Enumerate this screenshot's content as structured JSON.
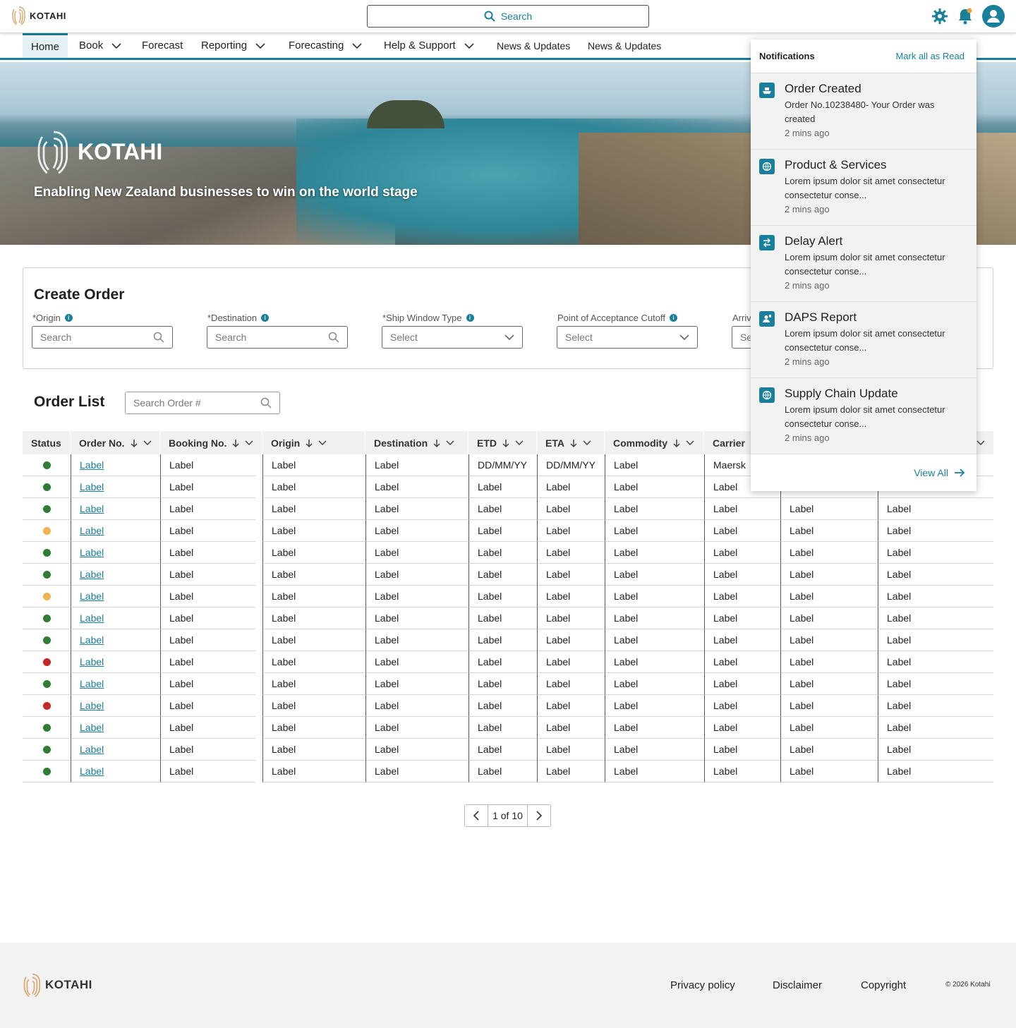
{
  "header": {
    "logo_text": "KOTAHI",
    "search_label": "Search"
  },
  "nav": {
    "items": [
      {
        "label": "Home"
      },
      {
        "label": "Book"
      },
      {
        "label": "Forecast"
      },
      {
        "label": "Reporting"
      },
      {
        "label": "Forecasting"
      },
      {
        "label": "Help & Support"
      },
      {
        "label": "News & Updates"
      },
      {
        "label": "News & Updates"
      }
    ]
  },
  "hero": {
    "logo_text": "KOTAHI",
    "tagline": "Enabling New Zealand businesses to win on the world stage"
  },
  "create_order": {
    "title": "Create Order",
    "fields": [
      {
        "label": "*Origin",
        "placeholder": "Search"
      },
      {
        "label": "*Destination",
        "placeholder": "Search"
      },
      {
        "label": "*Ship Window Type",
        "placeholder": "Select"
      },
      {
        "label": "Point of Acceptance Cutoff",
        "placeholder": "Select"
      },
      {
        "label": "Arriv",
        "placeholder": "Se"
      }
    ]
  },
  "order_list": {
    "title": "Order List",
    "search_placeholder": "Search Order #",
    "columns": [
      "Status",
      "Order No.",
      "Booking No.",
      "Origin",
      "Destination",
      "ETD",
      "ETA",
      "Commodity",
      "Carrier"
    ],
    "status_colors": {
      "green": "#2e7d32",
      "amber": "#f0b450",
      "red": "#c62828"
    },
    "rows": [
      {
        "status": "green",
        "order": "Label",
        "booking": "Label",
        "origin": "Label",
        "destination": "Label",
        "etd": "DD/MM/YY",
        "eta": "DD/MM/YY",
        "commodity": "Label",
        "carrier": "Maersk",
        "c10": "",
        "c11": ""
      },
      {
        "status": "green",
        "order": "Label",
        "booking": "Label",
        "origin": "Label",
        "destination": "Label",
        "etd": "Label",
        "eta": "Label",
        "commodity": "Label",
        "carrier": "Label",
        "c10": "",
        "c11": ""
      },
      {
        "status": "green",
        "order": "Label",
        "booking": "Label",
        "origin": "Label",
        "destination": "Label",
        "etd": "Label",
        "eta": "Label",
        "commodity": "Label",
        "carrier": "Label",
        "c10": "Label",
        "c11": "Label"
      },
      {
        "status": "amber",
        "order": "Label",
        "booking": "Label",
        "origin": "Label",
        "destination": "Label",
        "etd": "Label",
        "eta": "Label",
        "commodity": "Label",
        "carrier": "Label",
        "c10": "Label",
        "c11": "Label"
      },
      {
        "status": "green",
        "order": "Label",
        "booking": "Label",
        "origin": "Label",
        "destination": "Label",
        "etd": "Label",
        "eta": "Label",
        "commodity": "Label",
        "carrier": "Label",
        "c10": "Label",
        "c11": "Label"
      },
      {
        "status": "green",
        "order": "Label",
        "booking": "Label",
        "origin": "Label",
        "destination": "Label",
        "etd": "Label",
        "eta": "Label",
        "commodity": "Label",
        "carrier": "Label",
        "c10": "Label",
        "c11": "Label"
      },
      {
        "status": "amber",
        "order": "Label",
        "booking": "Label",
        "origin": "Label",
        "destination": "Label",
        "etd": "Label",
        "eta": "Label",
        "commodity": "Label",
        "carrier": "Label",
        "c10": "Label",
        "c11": "Label"
      },
      {
        "status": "green",
        "order": "Label",
        "booking": "Label",
        "origin": "Label",
        "destination": "Label",
        "etd": "Label",
        "eta": "Label",
        "commodity": "Label",
        "carrier": "Label",
        "c10": "Label",
        "c11": "Label"
      },
      {
        "status": "green",
        "order": "Label",
        "booking": "Label",
        "origin": "Label",
        "destination": "Label",
        "etd": "Label",
        "eta": "Label",
        "commodity": "Label",
        "carrier": "Label",
        "c10": "Label",
        "c11": "Label"
      },
      {
        "status": "red",
        "order": "Label",
        "booking": "Label",
        "origin": "Label",
        "destination": "Label",
        "etd": "Label",
        "eta": "Label",
        "commodity": "Label",
        "carrier": "Label",
        "c10": "Label",
        "c11": "Label"
      },
      {
        "status": "green",
        "order": "Label",
        "booking": "Label",
        "origin": "Label",
        "destination": "Label",
        "etd": "Label",
        "eta": "Label",
        "commodity": "Label",
        "carrier": "Label",
        "c10": "Label",
        "c11": "Label"
      },
      {
        "status": "red",
        "order": "Label",
        "booking": "Label",
        "origin": "Label",
        "destination": "Label",
        "etd": "Label",
        "eta": "Label",
        "commodity": "Label",
        "carrier": "Label",
        "c10": "Label",
        "c11": "Label"
      },
      {
        "status": "green",
        "order": "Label",
        "booking": "Label",
        "origin": "Label",
        "destination": "Label",
        "etd": "Label",
        "eta": "Label",
        "commodity": "Label",
        "carrier": "Label",
        "c10": "Label",
        "c11": "Label"
      },
      {
        "status": "green",
        "order": "Label",
        "booking": "Label",
        "origin": "Label",
        "destination": "Label",
        "etd": "Label",
        "eta": "Label",
        "commodity": "Label",
        "carrier": "Label",
        "c10": "Label",
        "c11": "Label"
      },
      {
        "status": "green",
        "order": "Label",
        "booking": "Label",
        "origin": "Label",
        "destination": "Label",
        "etd": "Label",
        "eta": "Label",
        "commodity": "Label",
        "carrier": "Label",
        "c10": "Label",
        "c11": "Label"
      }
    ]
  },
  "pagination": {
    "label": "1 of 10"
  },
  "notifications": {
    "title": "Notifications",
    "mark_all": "Mark all as Read",
    "items": [
      {
        "icon": "ship-icon",
        "title": "Order Created",
        "body": "Order No.10238480- Your Order was created",
        "time": "2 mins ago"
      },
      {
        "icon": "globe-icon",
        "title": "Product & Services",
        "body": "Lorem ipsum dolor sit amet consectetur consectetur conse...",
        "time": "2 mins ago"
      },
      {
        "icon": "swap-icon",
        "title": "Delay Alert",
        "body": "Lorem ipsum dolor sit amet consectetur consectetur conse...",
        "time": "2 mins ago"
      },
      {
        "icon": "user-report-icon",
        "title": "DAPS Report",
        "body": "Lorem ipsum dolor sit amet consectetur consectetur conse...",
        "time": "2 mins ago"
      },
      {
        "icon": "globe-icon",
        "title": "Supply Chain Update",
        "body": "Lorem ipsum dolor sit amet consectetur consectetur conse...",
        "time": "2 mins ago"
      }
    ],
    "view_all": "View All"
  },
  "footer": {
    "logo_text": "KOTAHI",
    "links": [
      "Privacy policy",
      "Disclaimer",
      "Copyright"
    ],
    "copyright": "© 2026 Kotahi"
  },
  "colors": {
    "accent": "#1a7f9a",
    "footer_bg": "#f2f2f2",
    "header_bg": "#f1f1f1"
  }
}
